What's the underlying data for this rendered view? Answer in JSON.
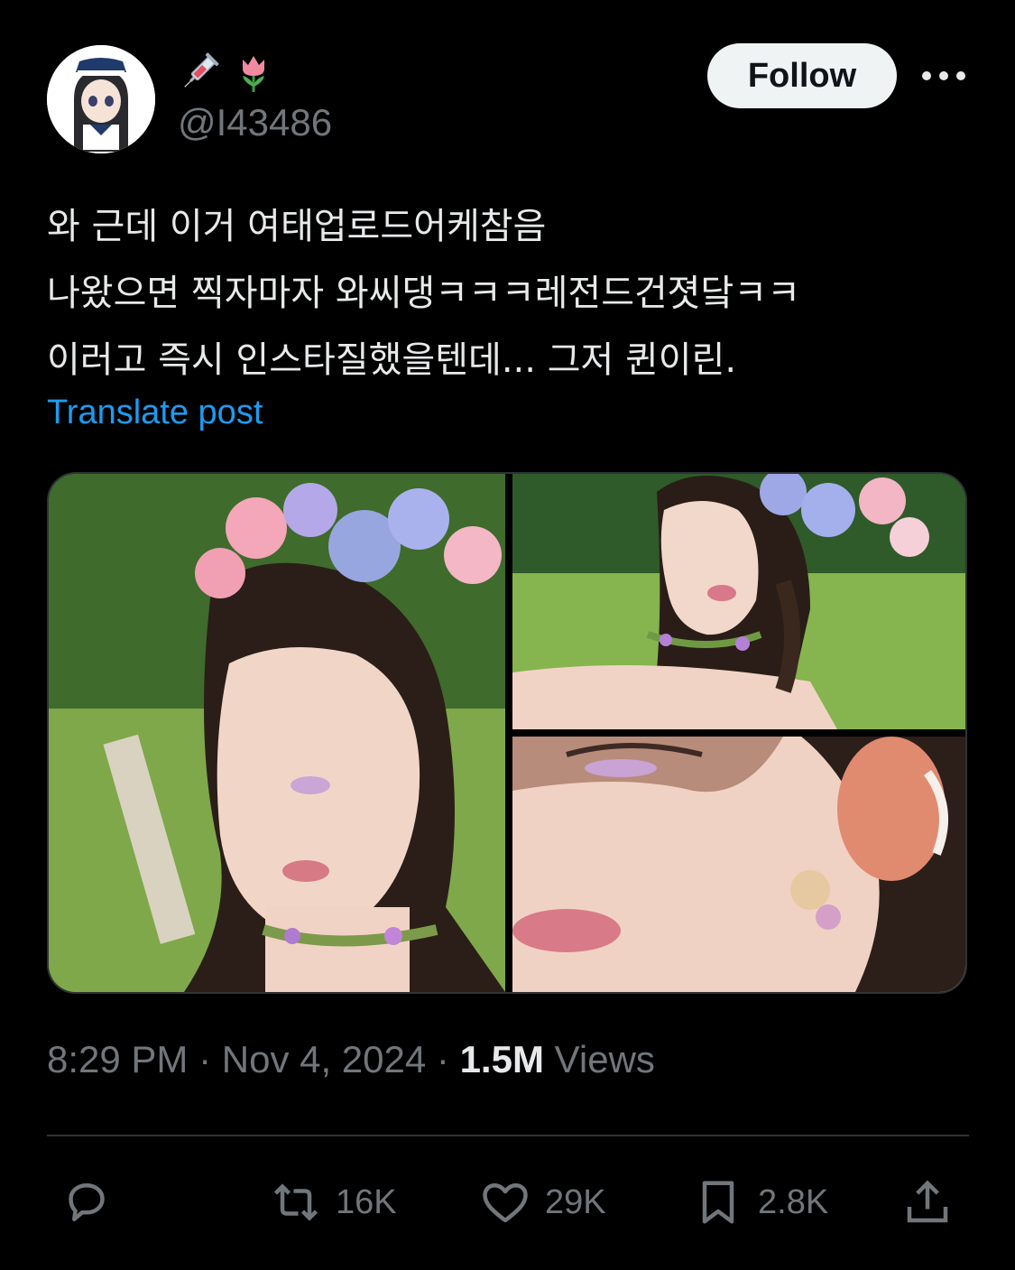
{
  "author": {
    "emoji": [
      "syringe-emoji",
      "tulip-emoji"
    ],
    "handle": "@I43486"
  },
  "follow_label": "Follow",
  "tweet": {
    "lines": [
      "와 근데 이거 여태업로드어케참음",
      "나왔으면 찍자마자 와씨댕ㅋㅋㅋ레전드건졋닼ㅋㅋ",
      "이러고 즉시 인스타질했을텐데... 그저 퀸이린."
    ],
    "translate_label": "Translate post"
  },
  "media": {
    "images": [
      {
        "icon": "photo-woman-flower-crown-profile"
      },
      {
        "icon": "photo-woman-braid-flower-crown"
      },
      {
        "icon": "photo-face-closeup-earring"
      }
    ]
  },
  "meta": {
    "time": "8:29 PM",
    "sep1": " · ",
    "date": "Nov 4, 2024",
    "sep2": " · ",
    "views_count": "1.5M",
    "views_label": " Views"
  },
  "actions": {
    "reply": {
      "icon": "reply-icon",
      "count": ""
    },
    "retweet": {
      "icon": "retweet-icon",
      "count": "16K"
    },
    "like": {
      "icon": "heart-icon",
      "count": "29K"
    },
    "bookmark": {
      "icon": "bookmark-icon",
      "count": "2.8K"
    },
    "share": {
      "icon": "share-icon"
    }
  },
  "colors": {
    "background": "#000000",
    "text": "#e7e9ea",
    "secondary": "#71767b",
    "link": "#1d9bf0",
    "follow_bg": "#eff3f4",
    "border": "#2f3336"
  }
}
